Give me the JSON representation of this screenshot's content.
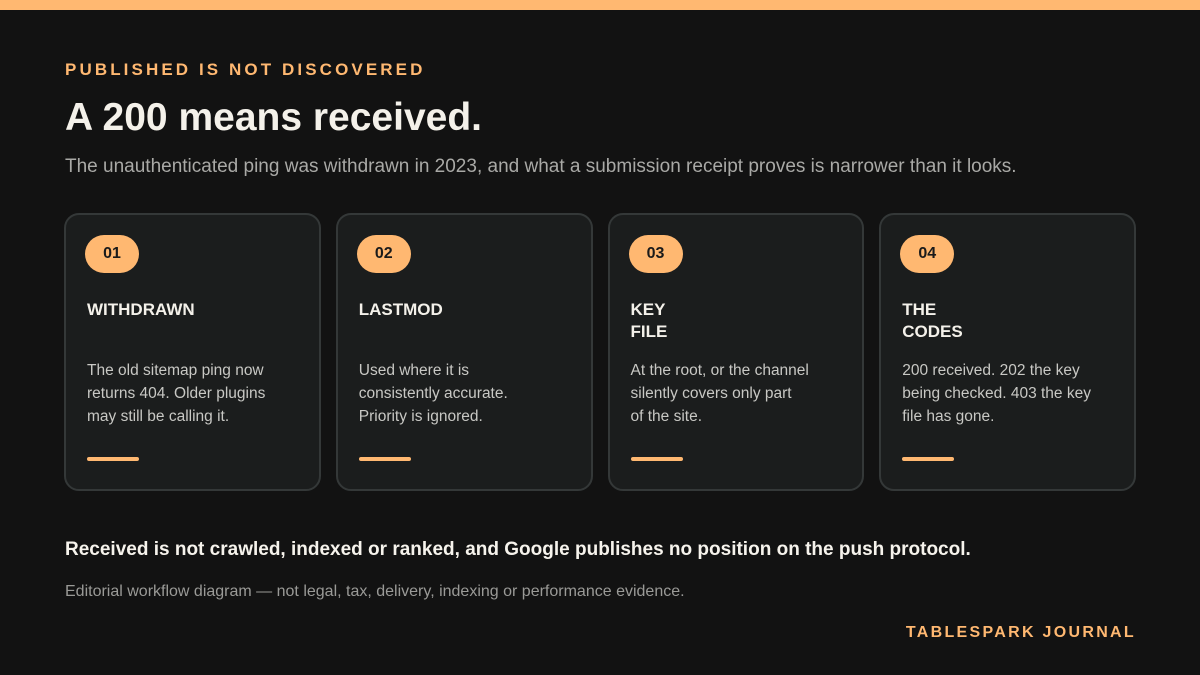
{
  "colors": {
    "accent": "#ffb871",
    "background": "#121212",
    "card": "#1b1d1d",
    "card_border": "#343838"
  },
  "header": {
    "kicker": "PUBLISHED IS NOT DISCOVERED",
    "title": "A 200 means received.",
    "subtitle": "The unauthenticated ping was withdrawn in 2023, and what a submission receipt proves is narrower than it looks."
  },
  "cards": [
    {
      "number": "01",
      "title": "WITHDRAWN",
      "body": "The old sitemap ping now\nreturns 404. Older plugins\nmay still be calling it."
    },
    {
      "number": "02",
      "title": "LASTMOD",
      "body": "Used where it is\nconsistently accurate.\nPriority is ignored."
    },
    {
      "number": "03",
      "title": "KEY\nFILE",
      "body": "At the root, or the channel\nsilently covers only part\nof the site."
    },
    {
      "number": "04",
      "title": "THE\nCODES",
      "body": "200 received. 202 the key\nbeing checked. 403 the key\nfile has gone."
    }
  ],
  "footer": {
    "takeaway": "Received is not crawled, indexed or ranked, and Google publishes no position on the push protocol.",
    "disclaimer": "Editorial workflow diagram — not legal, tax, delivery, indexing or performance evidence.",
    "brand": "TABLESPARK JOURNAL"
  }
}
